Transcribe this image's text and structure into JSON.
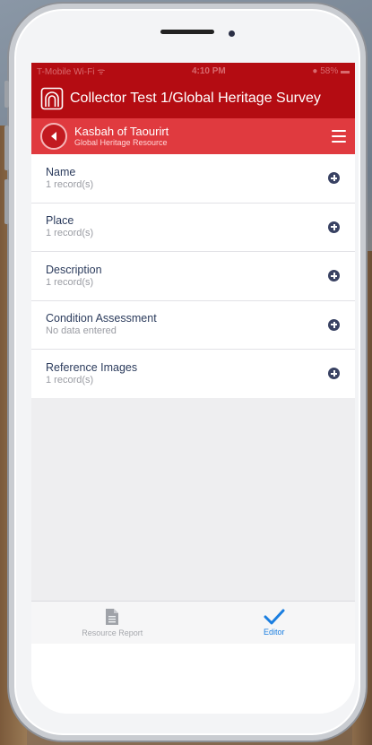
{
  "status_bar": {
    "carrier": "T-Mobile Wi-Fi ᯤ",
    "time": "4:10 PM",
    "battery": "● 58% ▬"
  },
  "header": {
    "title": "Collector Test 1/Global Heritage Survey",
    "logo_icon": "arches-logo-icon"
  },
  "record": {
    "title": "Kasbah of Taourirt",
    "subtitle": "Global Heritage Resource"
  },
  "cards": [
    {
      "title": "Name",
      "status": "1 record(s)"
    },
    {
      "title": "Place",
      "status": "1 record(s)"
    },
    {
      "title": "Description",
      "status": "1 record(s)"
    },
    {
      "title": "Condition Assessment",
      "status": "No data entered"
    },
    {
      "title": "Reference Images",
      "status": "1 record(s)"
    }
  ],
  "tabs": {
    "report": "Resource Report",
    "editor": "Editor"
  },
  "colors": {
    "header_red": "#b40c12",
    "record_bar_red": "#e03a3f",
    "add_icon": "#394263",
    "active_tab": "#1a7ee0"
  }
}
